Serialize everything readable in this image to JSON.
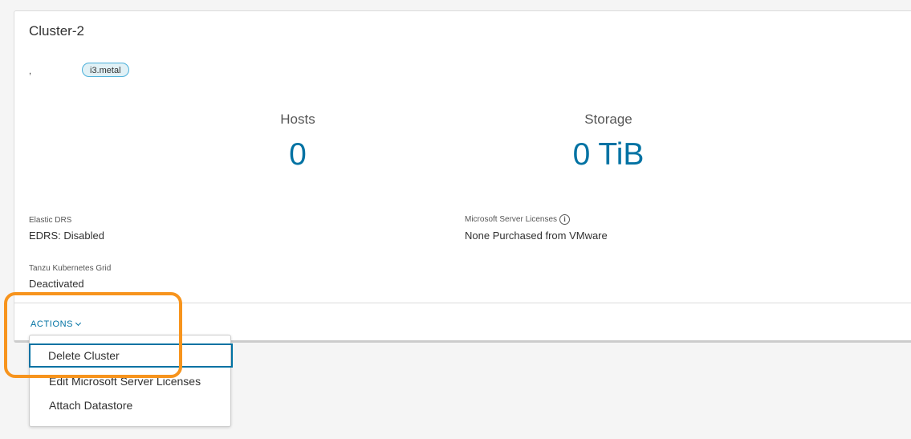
{
  "cluster": {
    "title": "Cluster-2",
    "region": ",",
    "instance_badge": "i3.metal"
  },
  "stats": {
    "hosts_label": "Hosts",
    "hosts_value": "0",
    "storage_label": "Storage",
    "storage_value": "0 TiB"
  },
  "fields": {
    "elastic_drs_label": "Elastic DRS",
    "elastic_drs_value": "EDRS: Disabled",
    "ms_licenses_label": "Microsoft Server Licenses",
    "ms_licenses_value": "None Purchased from VMware",
    "tanzu_label": "Tanzu Kubernetes Grid",
    "tanzu_value": "Deactivated"
  },
  "actions": {
    "label": "ACTIONS",
    "menu": [
      "Delete Cluster",
      "Edit Microsoft Server Licenses",
      "Attach Datastore"
    ]
  },
  "colors": {
    "accent": "#0072a3",
    "highlight": "#f7941d",
    "badge_bg": "#e1f1f6",
    "badge_border": "#49afd9"
  }
}
